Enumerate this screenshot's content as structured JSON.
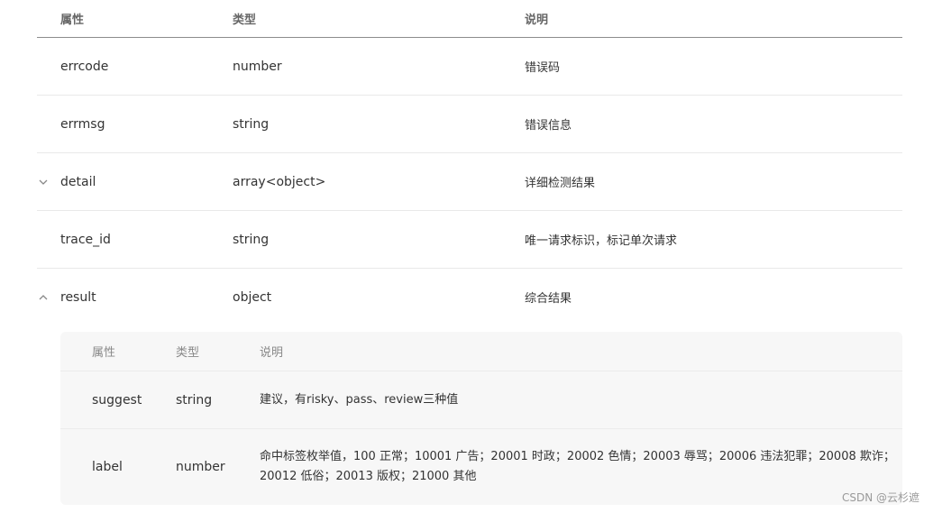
{
  "table": {
    "headers": [
      "属性",
      "类型",
      "说明"
    ],
    "rows": [
      {
        "name": "errcode",
        "type": "number",
        "desc": "错误码",
        "chevron": ""
      },
      {
        "name": "errmsg",
        "type": "string",
        "desc": "错误信息",
        "chevron": ""
      },
      {
        "name": "detail",
        "type": "array<object>",
        "desc": "详细检测结果",
        "chevron": "collapsed"
      },
      {
        "name": "trace_id",
        "type": "string",
        "desc": "唯一请求标识，标记单次请求",
        "chevron": ""
      },
      {
        "name": "result",
        "type": "object",
        "desc": "综合结果",
        "chevron": "expanded"
      }
    ]
  },
  "subtable": {
    "headers": [
      "属性",
      "类型",
      "说明"
    ],
    "rows": [
      {
        "name": "suggest",
        "type": "string",
        "desc": "建议，有risky、pass、review三种值"
      },
      {
        "name": "label",
        "type": "number",
        "desc": "命中标签枚举值，100 正常；10001 广告；20001 时政；20002 色情；20003 辱骂；20006 违法犯罪；20008 欺诈；20012 低俗；20013 版权；21000 其他"
      }
    ]
  },
  "watermark": "CSDN @云杉遮"
}
